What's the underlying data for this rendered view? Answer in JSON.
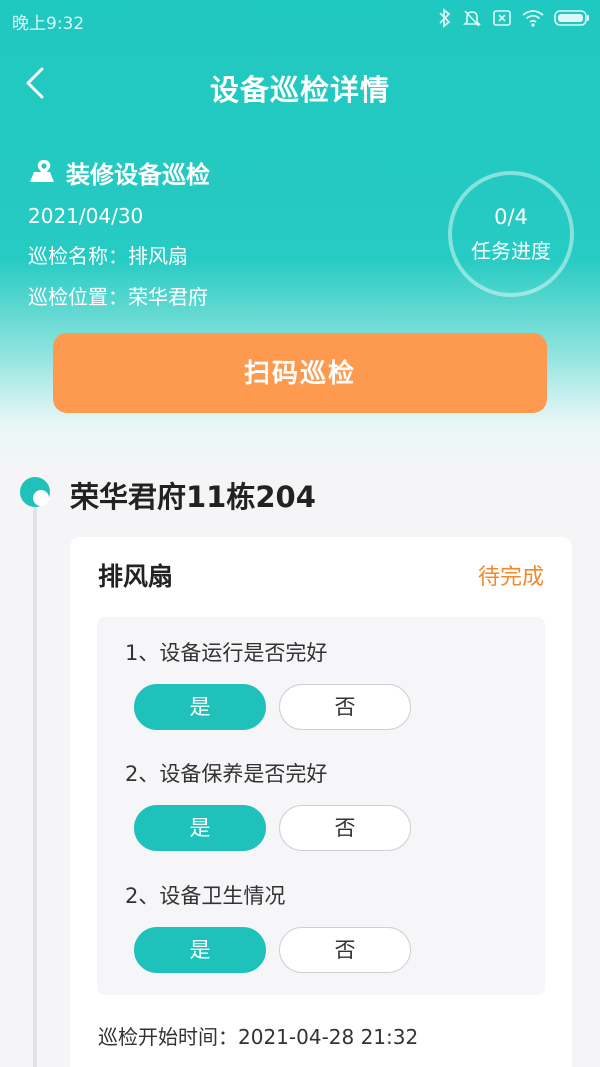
{
  "status_bar": {
    "time": "晚上9:32"
  },
  "nav": {
    "title": "设备巡检详情"
  },
  "task": {
    "title": "装修设备巡检",
    "date": "2021/04/30",
    "name_line": "巡检名称：排风扇",
    "location_line": "巡检位置：荣华君府"
  },
  "progress": {
    "count": "0/4",
    "label": "任务进度"
  },
  "scan_button": {
    "label": "扫码巡检"
  },
  "location": {
    "title": "荣华君府11栋204"
  },
  "device": {
    "name": "排风扇",
    "status": "待完成",
    "questions": [
      {
        "label": "1、设备运行是否完好",
        "yes": "是",
        "no": "否",
        "selected": "是"
      },
      {
        "label": "2、设备保养是否完好",
        "yes": "是",
        "no": "否",
        "selected": "是"
      },
      {
        "label": "2、设备卫生情况",
        "yes": "是",
        "no": "否",
        "selected": "是"
      }
    ],
    "start_time": "巡检开始时间：2021-04-28 21:32"
  },
  "colors": {
    "accent": "#1fc2bb",
    "orange_button": "#fd9a4f",
    "pending": "#f5892a"
  }
}
